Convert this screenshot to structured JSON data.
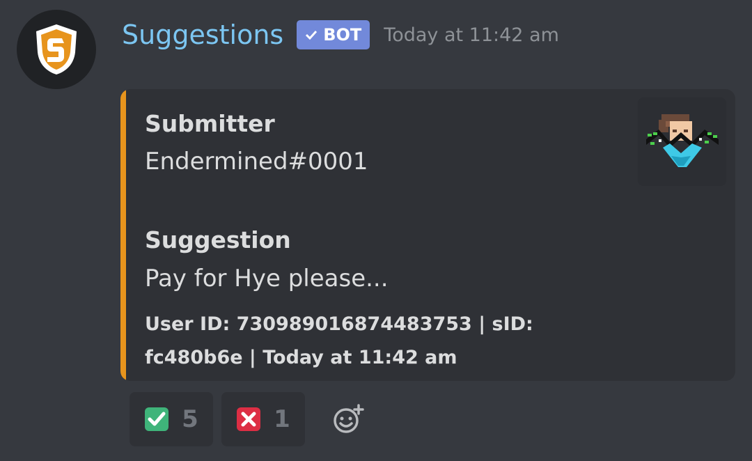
{
  "message": {
    "author": "Suggestions",
    "bot_tag": "BOT",
    "timestamp": "Today at 11:42 am",
    "avatar_icon": "shield-s-icon"
  },
  "embed": {
    "accent_color": "#e7941d",
    "fields": [
      {
        "name": "Submitter",
        "value": "Endermined#0001"
      },
      {
        "name": "Suggestion",
        "value": "Pay for Hye please..."
      }
    ],
    "footer_line1": "User ID: 730989016874483753 | sID:",
    "footer_line2": "fc480b6e | Today at 11:42 am",
    "thumbnail": "pixel-avatar-image"
  },
  "reactions": [
    {
      "emoji": "white-check-mark",
      "count": "5"
    },
    {
      "emoji": "cross-mark",
      "count": "1"
    }
  ],
  "colors": {
    "background": "#36393f",
    "embed_bg": "#2f3136",
    "username": "#7cc6f2",
    "bot_tag": "#7289da"
  }
}
